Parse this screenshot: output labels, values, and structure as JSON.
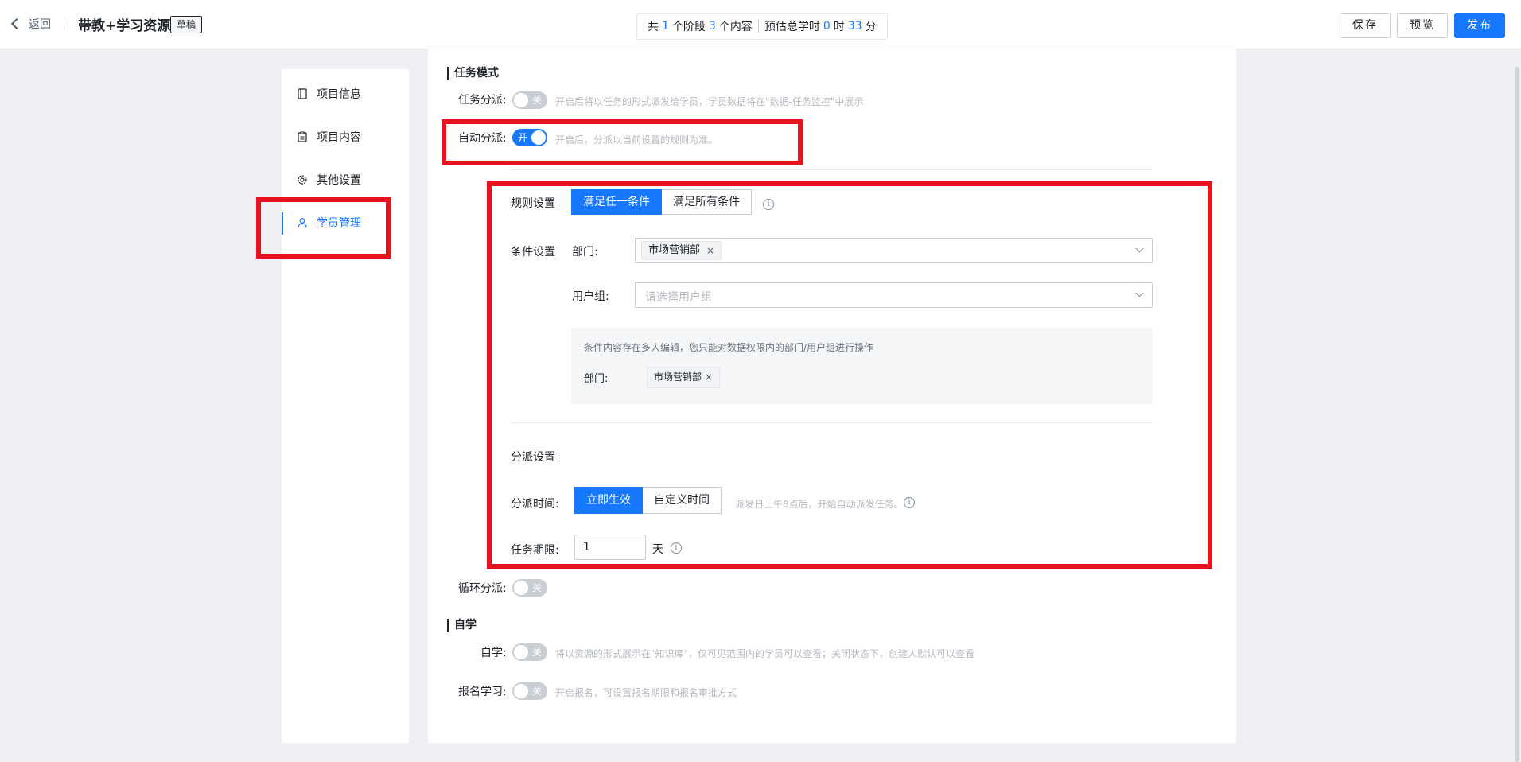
{
  "header": {
    "back_label": "返回",
    "title": "带教+学习资源",
    "draft_badge": "草稿",
    "summary": {
      "prefix": "共",
      "stages": "1",
      "stages_unit": "个阶段",
      "contents": "3",
      "contents_unit": "个内容",
      "est_label": "预估总学时",
      "hours": "0",
      "hours_unit": "时",
      "minutes": "33",
      "minutes_unit": "分"
    },
    "save_label": "保存",
    "preview_label": "预览",
    "publish_label": "发布"
  },
  "sidenav": {
    "items": [
      {
        "label": "项目信息",
        "icon": "book-icon"
      },
      {
        "label": "项目内容",
        "icon": "clipboard-icon"
      },
      {
        "label": "其他设置",
        "icon": "gear-icon"
      },
      {
        "label": "学员管理",
        "icon": "user-icon",
        "active": true
      }
    ]
  },
  "task_mode": {
    "section_title": "任务模式",
    "task_dispatch": {
      "label": "任务分派:",
      "toggle": "关",
      "hint": "开启后将以任务的形式派发给学员，学员数据将在\"数据-任务监控\"中展示"
    },
    "auto_dispatch": {
      "label": "自动分派:",
      "toggle": "开",
      "hint": "开启后，分派以当前设置的规则为准。"
    },
    "rule": {
      "label": "规则设置",
      "options": [
        "满足任一条件",
        "满足所有条件"
      ],
      "selected": "满足任一条件"
    },
    "conditions": {
      "label": "条件设置",
      "department_label": "部门:",
      "department_tag": "市场营销部",
      "usergroup_label": "用户组:",
      "usergroup_placeholder": "请选择用户组",
      "notice_text": "条件内容存在多人编辑，您只能对数据权限内的部门/用户组进行操作",
      "notice_department_label": "部门:",
      "notice_department_tag": "市场营销部"
    },
    "dispatch_settings": {
      "title": "分派设置",
      "time_label": "分派时间:",
      "time_options": [
        "立即生效",
        "自定义时间"
      ],
      "time_selected": "立即生效",
      "time_hint": "派发日上午8点后，开始自动派发任务。",
      "deadline_label": "任务期限:",
      "deadline_value": "1",
      "deadline_unit": "天"
    },
    "loop_dispatch": {
      "label": "循环分派:",
      "toggle": "关"
    }
  },
  "self_study": {
    "section_title": "自学",
    "self_study": {
      "label": "自学:",
      "toggle": "关",
      "hint": "将以资源的形式展示在\"知识库\"，仅可见范围内的学员可以查看；关闭状态下，创建人默认可以查看"
    },
    "enroll": {
      "label": "报名学习:",
      "toggle": "关",
      "hint": "开启报名，可设置报名期限和报名审批方式"
    }
  },
  "colors": {
    "accent": "#1677ff",
    "highlight_box": "#e8121f"
  }
}
